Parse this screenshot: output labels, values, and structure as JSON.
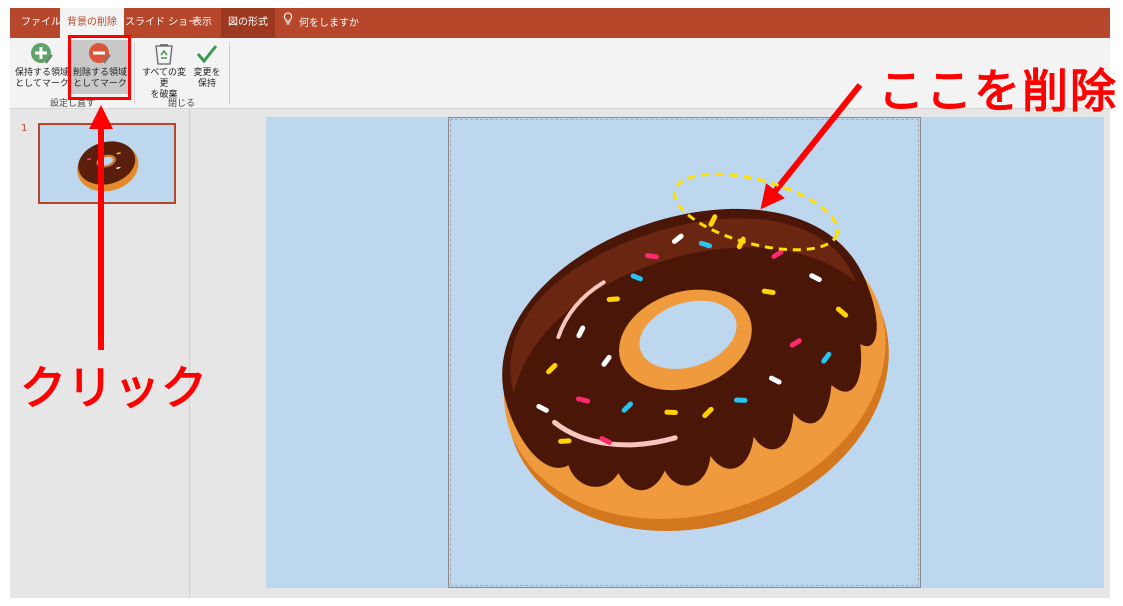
{
  "tabs": {
    "file": "ファイル",
    "background_removal": "背景の削除",
    "slideshow": "スライド ショー",
    "view": "表示",
    "picture_format": "図の形式",
    "tell_me": "何をしますか"
  },
  "ribbon": {
    "mark_keep": "保持する領域\nとしてマーク",
    "mark_remove": "削除する領域\nとしてマーク",
    "discard_all": "すべての変更\nを破棄",
    "keep_changes": "変更を\n保持",
    "group_refine": "設定し直す",
    "group_close": "閉じる"
  },
  "thumbnails": {
    "slide_number": "1"
  },
  "annotations": {
    "click_label": "クリック",
    "delete_here_label": "ここを削除"
  },
  "colors": {
    "accent": "#b7472a",
    "annotation_red": "#ff0000",
    "annotation_yellow": "#ffe000",
    "slide_background": "#bdd7ee"
  },
  "icons": [
    "plus-circle-icon",
    "minus-circle-icon",
    "recycle-bin-icon",
    "checkmark-icon",
    "lightbulb-icon"
  ]
}
